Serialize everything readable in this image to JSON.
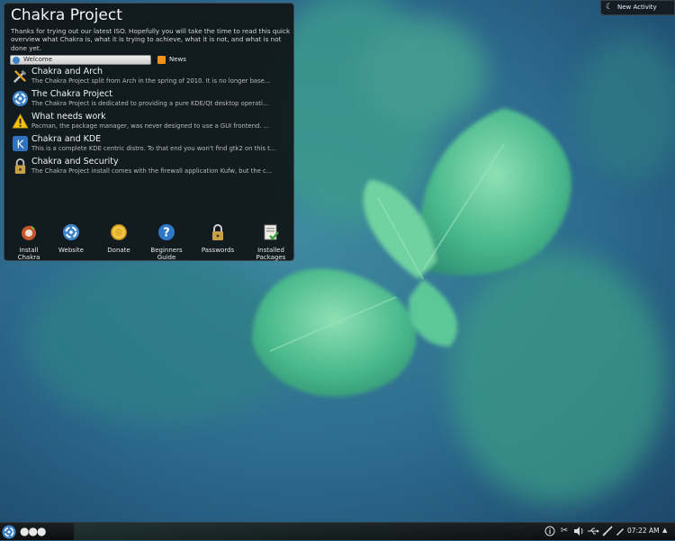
{
  "widget": {
    "title": "Chakra Project",
    "intro": "Thanks for trying out our latest ISO.  Hopefully you will take the time to read this quick overview what Chakra is, what it is trying to achieve, what it is not, and what is not done yet.",
    "tabs": {
      "welcome": "Welcome",
      "news": "News"
    },
    "news_items": [
      {
        "icon": "tools-icon",
        "title": "Chakra and Arch",
        "summary": "The Chakra Project split from Arch in the spring of 2010. It is no longer base..."
      },
      {
        "icon": "chakra-logo-icon",
        "title": "The Chakra Project",
        "summary": "The Chakra Project is dedicated to providing a pure KDE/Qt desktop operati..."
      },
      {
        "icon": "warning-icon",
        "title": "What needs work",
        "summary": "Pacman, the package manager, was never designed to use a GUI frontend. ..."
      },
      {
        "icon": "kde-icon",
        "title": "Chakra and KDE",
        "summary": "This is a complete KDE centric distro. To that end you won't find gtk2 on this t..."
      },
      {
        "icon": "lock-icon",
        "title": "Chakra and Security",
        "summary": "The Chakra Project install comes with the firewall application Kufw, but the c..."
      }
    ],
    "launchers": [
      {
        "icon": "install-icon",
        "label": "Install\nChakra"
      },
      {
        "icon": "website-icon",
        "label": "Website"
      },
      {
        "icon": "donate-icon",
        "label": "Donate"
      },
      {
        "icon": "help-icon",
        "label": "Beginners\nGuide"
      },
      {
        "icon": "passwords-icon",
        "label": "Passwords"
      },
      {
        "icon": "packages-icon",
        "label": "Installed\nPackages"
      }
    ]
  },
  "activity": {
    "label": "New Activity",
    "icon": "activity-icon"
  },
  "panel": {
    "launcher_icon": "chakra-menu-icon",
    "pager": "●●●",
    "tray_icons": [
      "info-icon",
      "scissors-icon",
      "volume-icon",
      "usb-icon",
      "network-icon",
      "edit-icon"
    ],
    "clock": "07:22 AM",
    "tray_expand": "▲"
  },
  "colors": {
    "accent": "#3f84c8",
    "panel": "#101314",
    "leaf": "#4fbf92"
  }
}
